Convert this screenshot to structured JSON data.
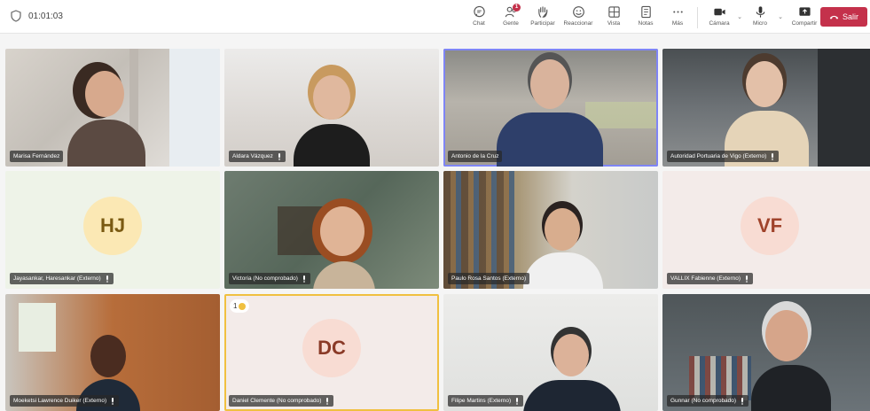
{
  "meeting": {
    "timer": "01:01:03",
    "toolbar": {
      "chat": "Chat",
      "people": "Gente",
      "people_badge": "1",
      "raise": "Participar",
      "react": "Reaccionar",
      "view": "Vista",
      "notes": "Notas",
      "more": "Más",
      "camera": "Cámara",
      "mic": "Micro",
      "share": "Compartir",
      "leave": "Salir"
    },
    "tiles": [
      {
        "name": "Marisa Fernández"
      },
      {
        "name": "Aldara Vázquez"
      },
      {
        "name": "Antonio de la Cruz"
      },
      {
        "name": "Autoridad Portuaria de Vigo (Externo)"
      },
      {
        "name": "Jayasankar, Haresankar (Externo)",
        "initials": "HJ"
      },
      {
        "name": "Victoria (No comprobado)"
      },
      {
        "name": "Paulo Rosa Santos (Externo)"
      },
      {
        "name": "VALLIX Fabienne (Externo)",
        "initials": "VF"
      },
      {
        "name": "Moeketsi Lawrence Duiker (Externo)"
      },
      {
        "name": "Daniel Clemente (No comprobado)",
        "initials": "DC",
        "hand_count": "1"
      },
      {
        "name": "Filipe Martins (Externo)"
      },
      {
        "name": "Gunnar (No comprobado)"
      }
    ]
  },
  "colors": {
    "leave": "#c4314b",
    "speaking_outline": "#7f85f5",
    "hand_outline": "#f0c040"
  }
}
